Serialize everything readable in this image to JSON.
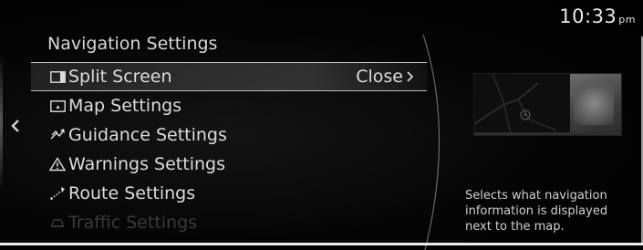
{
  "status_bar": {
    "time": "10:33",
    "ampm": "pm"
  },
  "header": {
    "title": "Navigation Settings"
  },
  "menu": {
    "items": [
      {
        "label": "Split Screen",
        "value": "Close",
        "icon": "split-screen-icon",
        "selected": true
      },
      {
        "label": "Map Settings",
        "icon": "map-icon"
      },
      {
        "label": "Guidance Settings",
        "icon": "guidance-icon"
      },
      {
        "label": "Warnings Settings",
        "icon": "warning-icon"
      },
      {
        "label": "Route Settings",
        "icon": "route-icon"
      },
      {
        "label": "Traffic Settings",
        "icon": "traffic-icon",
        "faded": true
      }
    ]
  },
  "info_panel": {
    "description": "Selects what navigation information is displayed next to the map."
  },
  "colors": {
    "background": "#000000",
    "text": "#dcdcdc",
    "selection_border": "#bdbdbd"
  }
}
